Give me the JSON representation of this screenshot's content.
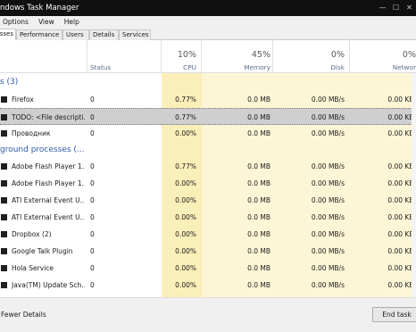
{
  "window": {
    "title": "ndows Task Manager",
    "controls": [
      "—",
      "☐",
      "✕"
    ]
  },
  "menu": [
    "Options",
    "View",
    "Help"
  ],
  "tabs": [
    {
      "label": "sses",
      "active": true
    },
    {
      "label": "Performance"
    },
    {
      "label": "Users"
    },
    {
      "label": "Details"
    },
    {
      "label": "Services"
    }
  ],
  "columns": {
    "status": "Status",
    "cpu": {
      "pct": "10%",
      "label": "CPU"
    },
    "memory": {
      "pct": "45%",
      "label": "Memory"
    },
    "disk": {
      "pct": "0%",
      "label": "Disk"
    },
    "network": {
      "pct": "0%",
      "label": "Networ"
    }
  },
  "sections": [
    {
      "title": "s (3)"
    },
    {
      "title": "ground processes (..."
    }
  ],
  "apps": [
    {
      "name": "Firefox",
      "status": "0",
      "cpu": "0.77%",
      "memory": "0.0 MB",
      "disk": "0.00 MB/s",
      "network": "0.00 KB/"
    },
    {
      "name": "TODO: <File descripti...",
      "status": "0",
      "cpu": "0.77%",
      "memory": "0.0 MB",
      "disk": "0.00 MB/s",
      "network": "0.00 KB/",
      "selected": true
    },
    {
      "name": "Проводник",
      "status": "0",
      "cpu": "0.00%",
      "memory": "0.0 MB",
      "disk": "0.00 MB/s",
      "network": "0.00 KB/"
    }
  ],
  "background": [
    {
      "name": "Adobe Flash Player 1...",
      "status": "0",
      "cpu": "0.77%",
      "memory": "0.0 MB",
      "disk": "0.00 MB/s",
      "network": "0.00 KB/"
    },
    {
      "name": "Adobe Flash Player 1...",
      "status": "0",
      "cpu": "0.00%",
      "memory": "0.0 MB",
      "disk": "0.00 MB/s",
      "network": "0.00 KB/"
    },
    {
      "name": "ATI External Event U...",
      "status": "0",
      "cpu": "0.00%",
      "memory": "0.0 MB",
      "disk": "0.00 MB/s",
      "network": "0.00 KB/"
    },
    {
      "name": "ATI External Event U...",
      "status": "0",
      "cpu": "0.00%",
      "memory": "0.0 MB",
      "disk": "0.00 MB/s",
      "network": "0.00 KB/"
    },
    {
      "name": "Dropbox (2)",
      "status": "0",
      "cpu": "0.00%",
      "memory": "0.0 MB",
      "disk": "0.00 MB/s",
      "network": "0.00 KB/"
    },
    {
      "name": "Google Talk Plugin",
      "status": "0",
      "cpu": "0.00%",
      "memory": "0.0 MB",
      "disk": "0.00 MB/s",
      "network": "0.00 KB/"
    },
    {
      "name": "Hola Service",
      "status": "0",
      "cpu": "0.00%",
      "memory": "0.0 MB",
      "disk": "0.00 MB/s",
      "network": "0.00 KB/"
    },
    {
      "name": "Java(TM) Update Sch...",
      "status": "0",
      "cpu": "0.00%",
      "memory": "0.0 MB",
      "disk": "0.00 MB/s",
      "network": "0.00 KB/"
    }
  ],
  "footer": {
    "fewer_details": "Fewer Details",
    "end_task": "End task"
  },
  "colors": {
    "cpu_bg": "#fbefb9",
    "col_bg": "#fdf6d6",
    "section_text": "#2f5aa8"
  }
}
